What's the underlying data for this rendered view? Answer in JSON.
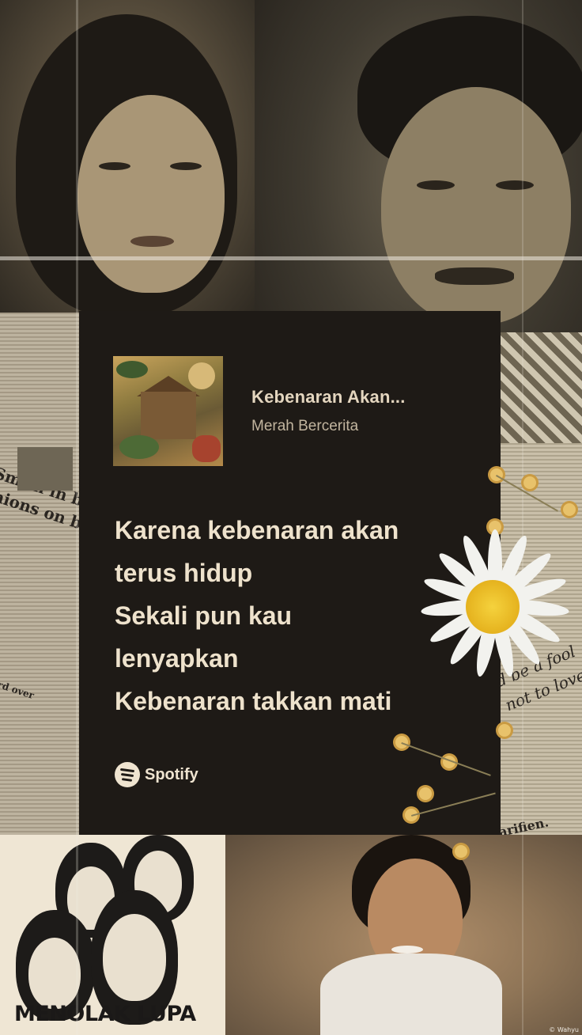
{
  "track": {
    "title": "Kebenaran Akan...",
    "artist": "Merah Bercerita"
  },
  "lyrics": [
    "Karena kebenaran akan",
    "terus hidup",
    "Sekali pun kau",
    "lenyapkan",
    "Kebenaran takkan mati"
  ],
  "brand": {
    "name": "Spotify",
    "icon": "spotify-icon"
  },
  "poster": {
    "caption": "MENOLAK LUPA"
  },
  "newspaper_left": [
    "Smith in ba",
    "nions on ble",
    "rd over"
  ],
  "newspaper_right": [
    "d be a fool",
    "not to love",
    "Coldarifien."
  ],
  "credit": "© Wahyu",
  "colors": {
    "card_bg": "#1e1a16",
    "lyric_text": "#eee2cc",
    "daisy_center": "#f5d23d"
  }
}
